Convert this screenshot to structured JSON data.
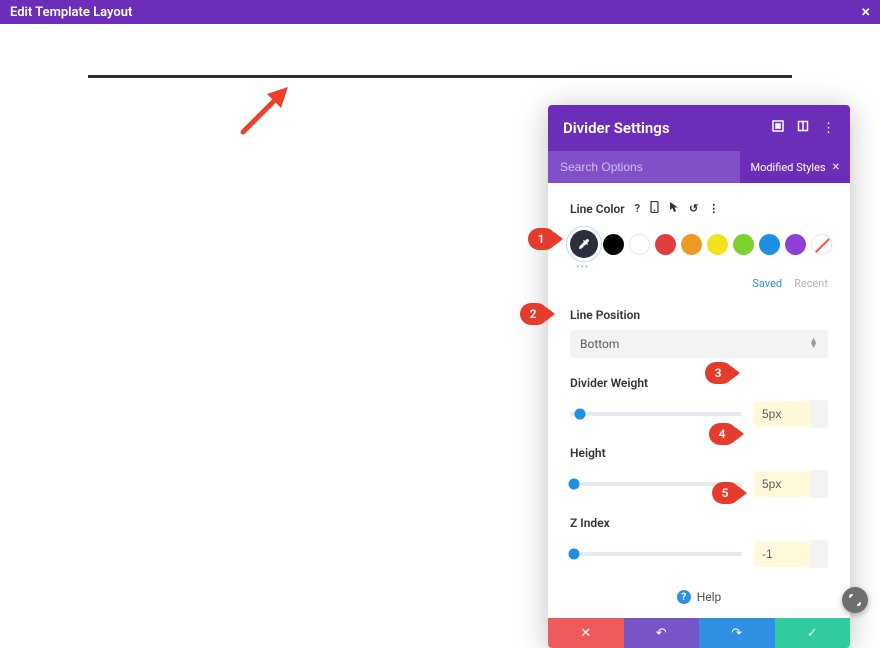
{
  "topbar": {
    "title": "Edit Template Layout"
  },
  "panel": {
    "title": "Divider Settings",
    "search_placeholder": "Search Options",
    "modified_label": "Modified Styles"
  },
  "line_color": {
    "label": "Line Color",
    "saved": "Saved",
    "recent": "Recent",
    "swatches": [
      "#000000",
      "#ffffff",
      "#e43d3d",
      "#ec9a26",
      "#f2e21e",
      "#7bd22d",
      "#1d8fe4",
      "#8e3fd6"
    ]
  },
  "line_position": {
    "label": "Line Position",
    "value": "Bottom"
  },
  "divider_weight": {
    "label": "Divider Weight",
    "value": "5px"
  },
  "height": {
    "label": "Height",
    "value": "5px"
  },
  "z_index": {
    "label": "Z Index",
    "value": "-1"
  },
  "help": {
    "label": "Help"
  },
  "callouts": {
    "c1": "1",
    "c2": "2",
    "c3": "3",
    "c4": "4",
    "c5": "5"
  }
}
